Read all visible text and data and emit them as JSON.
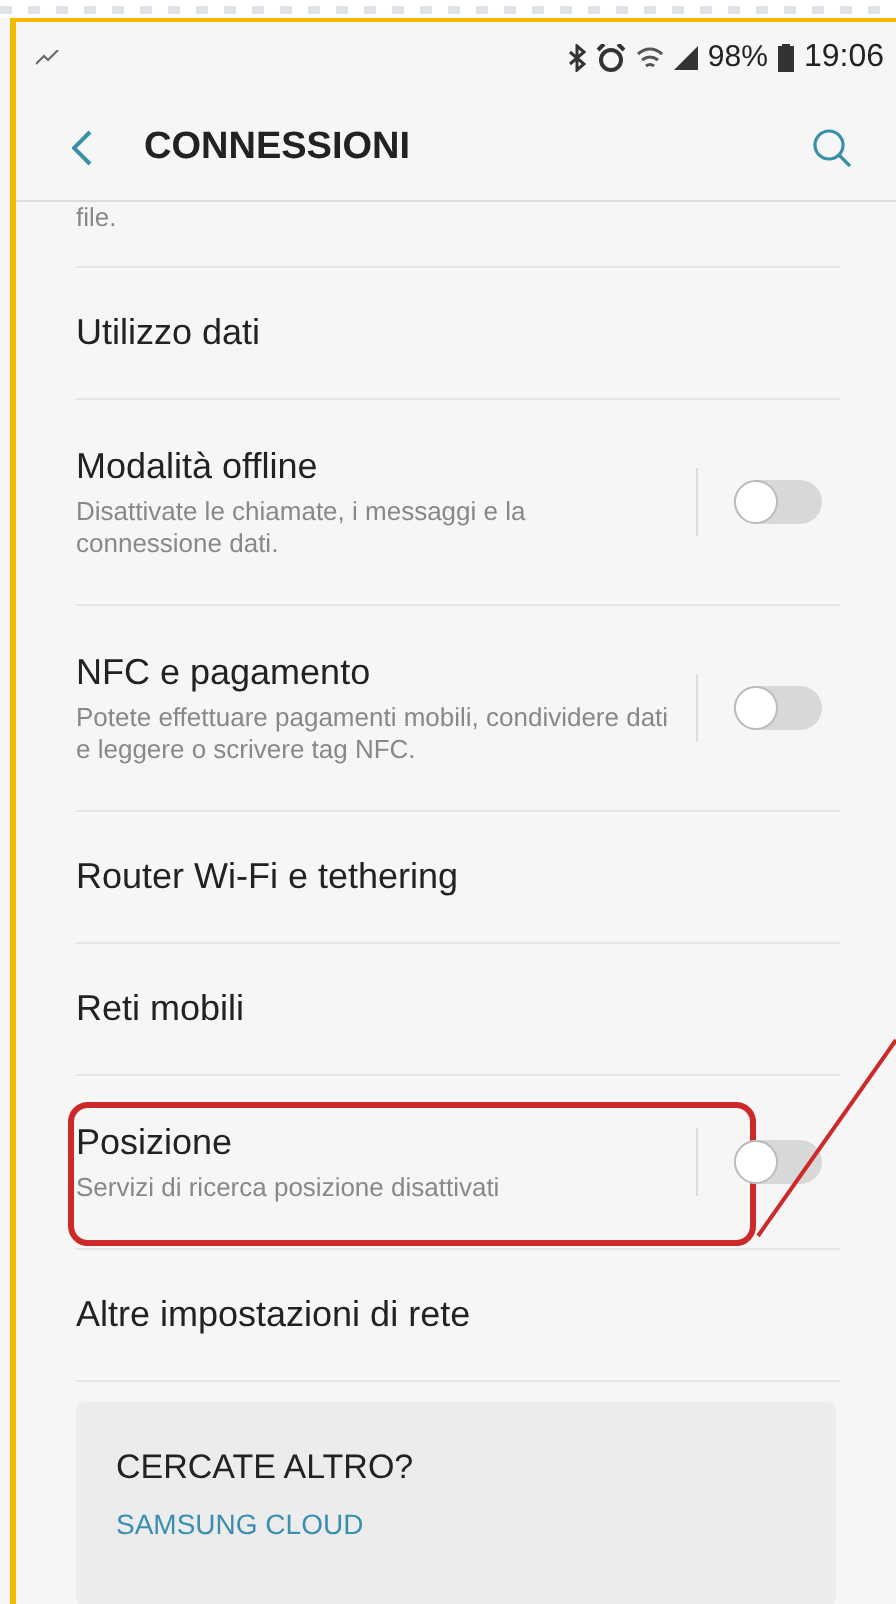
{
  "status_bar": {
    "battery": "98%",
    "time": "19:06"
  },
  "header": {
    "title": "CONNESSIONI"
  },
  "partial_text": "file.",
  "settings": [
    {
      "kind": "plain",
      "title": "Utilizzo dati"
    },
    {
      "kind": "toggle",
      "title": "Modalità offline",
      "subtitle": "Disattivate le chiamate, i messaggi e la connessione dati.",
      "on": false
    },
    {
      "kind": "toggle",
      "title": "NFC e pagamento",
      "subtitle": "Potete effettuare pagamenti mobili, condividere dati e leggere o scrivere tag NFC.",
      "on": false
    },
    {
      "kind": "plain",
      "title": "Router Wi-Fi e tethering"
    },
    {
      "kind": "plain",
      "title": "Reti mobili"
    },
    {
      "kind": "toggle",
      "title": "Posizione",
      "subtitle": "Servizi di ricerca posizione disattivati",
      "on": false,
      "highlighted": true
    },
    {
      "kind": "plain",
      "title": "Altre impostazioni di rete"
    }
  ],
  "suggestions": {
    "title": "CERCATE ALTRO?",
    "links": [
      "SAMSUNG CLOUD"
    ]
  }
}
